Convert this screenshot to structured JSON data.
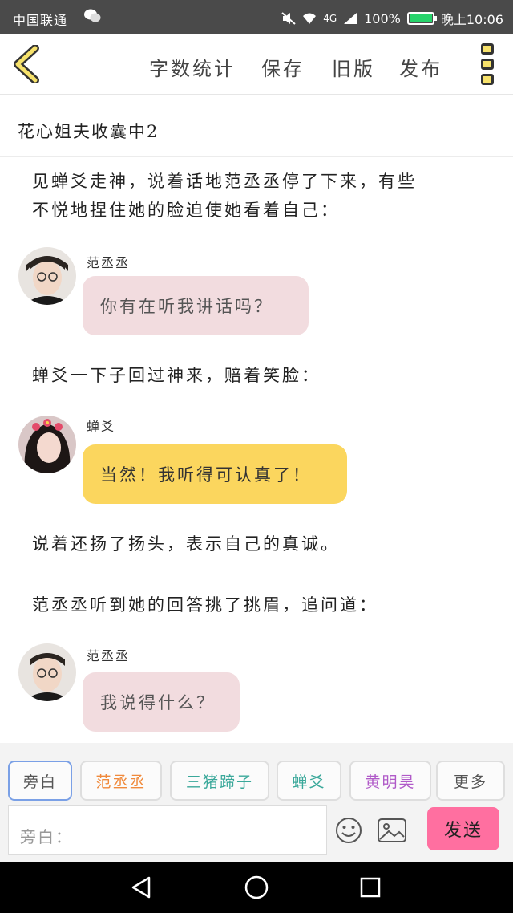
{
  "status_bar": {
    "carrier": "中国联通",
    "battery": "100%",
    "battery_level": 1.0,
    "time": "晚上10:06",
    "network": "4G"
  },
  "header": {
    "menu": [
      "字数统计",
      "保存",
      "旧版",
      "发布"
    ]
  },
  "story": {
    "title": "花心姐夫收囊中2"
  },
  "content": {
    "narration_1_line1": "见蝉爻走神，说着话地范丞丞停了下来，有些",
    "narration_1_line2": "不悦地捏住她的脸迫使她看着自己：",
    "msg_1_speaker": "范丞丞",
    "msg_1_text": "你有在听我讲话吗？",
    "narration_2": "蝉爻一下子回过神来，赔着笑脸：",
    "msg_2_speaker": "蝉爻",
    "msg_2_text": "当然！我听得可认真了！",
    "narration_3": "说着还扬了扬头，表示自己的真诚。",
    "narration_4": "范丞丞听到她的回答挑了挑眉，追问道：",
    "msg_3_speaker": "范丞丞",
    "msg_3_text": "我说得什么？"
  },
  "roles": {
    "items": [
      "旁白",
      "范丞丞",
      "三猪蹄子",
      "蝉爻",
      "黄明昊",
      "更多"
    ],
    "colors": [
      "#555555",
      "#f08a3c",
      "#3aa89a",
      "#3aa89a",
      "#b05ac8",
      "#555555"
    ],
    "active_index": 0
  },
  "composer": {
    "placeholder": "旁白：",
    "send_label": "发送"
  }
}
